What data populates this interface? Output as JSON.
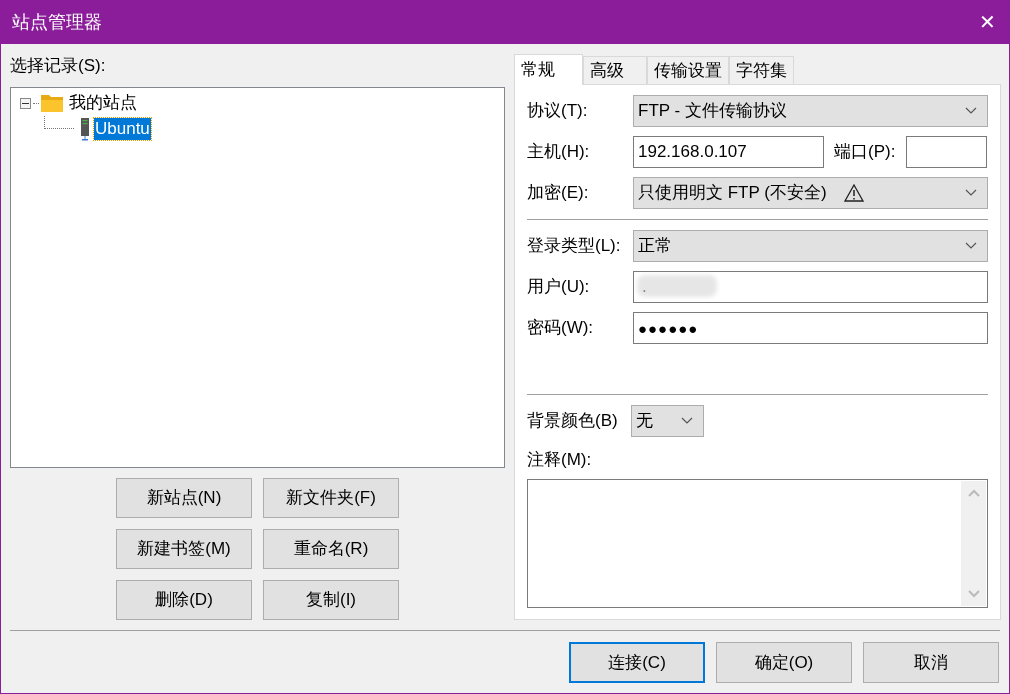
{
  "window": {
    "title": "站点管理器",
    "close": "✕"
  },
  "left": {
    "label": "选择记录(S):",
    "tree": [
      {
        "label": "我的站点",
        "kind": "folder",
        "expanded": true,
        "selected": false,
        "children": [
          {
            "label": "Ubuntu",
            "kind": "server",
            "selected": true
          }
        ]
      }
    ],
    "buttons": [
      "新站点(N)",
      "新文件夹(F)",
      "新建书签(M)",
      "重命名(R)",
      "删除(D)",
      "复制(I)"
    ]
  },
  "tabs": [
    {
      "label": "常规",
      "selected": true
    },
    {
      "label": "高级",
      "selected": false
    },
    {
      "label": "传输设置",
      "selected": false
    },
    {
      "label": "字符集",
      "selected": false
    }
  ],
  "form": {
    "protocol": {
      "label": "协议(T):",
      "value": "FTP - 文件传输协议"
    },
    "host": {
      "label": "主机(H):",
      "value": "192.168.0.107"
    },
    "port": {
      "label": "端口(P):"
    },
    "encryption": {
      "label": "加密(E):",
      "value": "只使用明文 FTP (不安全)",
      "warning": true
    },
    "login_type": {
      "label": "登录类型(L):",
      "value": "正常"
    },
    "user": {
      "label": "用户(U):",
      "value": ".",
      "redacted": true
    },
    "password": {
      "label": "密码(W):",
      "value": "●●●●●●"
    },
    "background_color": {
      "label": "背景颜色(B)",
      "value": "无"
    },
    "comment": {
      "label": "注释(M):"
    }
  },
  "footer_buttons": [
    {
      "label": "连接(C)",
      "default": true
    },
    {
      "label": "确定(O)",
      "default": false
    },
    {
      "label": "取消",
      "default": false
    }
  ]
}
